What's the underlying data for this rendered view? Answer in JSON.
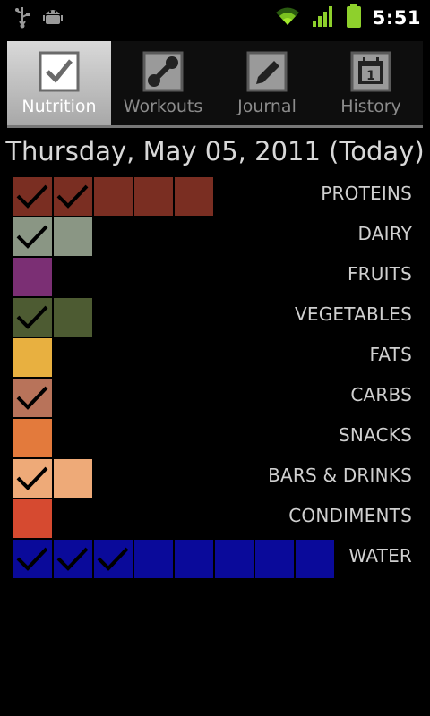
{
  "status_bar": {
    "time": "5:51",
    "icons": [
      "usb-icon",
      "android-debug-icon",
      "wifi-icon",
      "signal-icon",
      "battery-icon"
    ]
  },
  "tabs": [
    {
      "label": "Nutrition",
      "icon": "check-icon",
      "active": true
    },
    {
      "label": "Workouts",
      "icon": "dumbbell-icon",
      "active": false
    },
    {
      "label": "Journal",
      "icon": "pencil-icon",
      "active": false
    },
    {
      "label": "History",
      "icon": "calendar-icon",
      "active": false
    }
  ],
  "history_calendar_day": "1",
  "date_title": "Thursday, May 05, 2011 (Today)",
  "food_groups": [
    {
      "label": "PROTEINS",
      "color": "#7a2e22",
      "boxes": 5,
      "checked": 2
    },
    {
      "label": "DAIRY",
      "color": "#8a9684",
      "boxes": 2,
      "checked": 1
    },
    {
      "label": "FRUITS",
      "color": "#7b2f74",
      "boxes": 1,
      "checked": 0
    },
    {
      "label": "VEGETABLES",
      "color": "#4d5b32",
      "boxes": 2,
      "checked": 1
    },
    {
      "label": "FATS",
      "color": "#e8b040",
      "boxes": 1,
      "checked": 0
    },
    {
      "label": "CARBS",
      "color": "#b8735a",
      "boxes": 1,
      "checked": 1
    },
    {
      "label": "SNACKS",
      "color": "#e37a3c",
      "boxes": 1,
      "checked": 0
    },
    {
      "label": "BARS & DRINKS",
      "color": "#eeaa78",
      "boxes": 2,
      "checked": 1
    },
    {
      "label": "CONDIMENTS",
      "color": "#d64a30",
      "boxes": 1,
      "checked": 0
    },
    {
      "label": "WATER",
      "color": "#0a0a9a",
      "boxes": 8,
      "checked": 3
    }
  ]
}
